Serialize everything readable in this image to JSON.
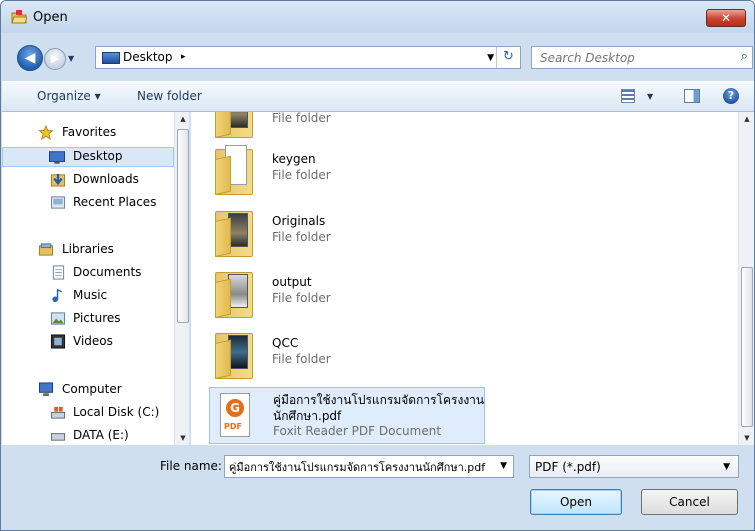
{
  "window": {
    "title": "Open",
    "close_label": "✕"
  },
  "nav": {
    "back_label": "◀",
    "forward_label": "▶",
    "address": {
      "crumb": "Desktop",
      "crumb_arrow": "▸"
    },
    "refresh_label": "↻",
    "search_placeholder": "Search Desktop",
    "search_icon": "search-icon"
  },
  "toolbar": {
    "organize_label": "Organize ▾",
    "new_folder_label": "New folder",
    "help_label": "?"
  },
  "sidebar": {
    "items": [
      {
        "label": "Favorites",
        "icon": "star-icon"
      },
      {
        "label": "Desktop",
        "icon": "desktop-icon",
        "selected": true
      },
      {
        "label": "Downloads",
        "icon": "downloads-icon"
      },
      {
        "label": "Recent Places",
        "icon": "recent-places-icon"
      },
      {
        "label": "Libraries",
        "icon": "libraries-icon"
      },
      {
        "label": "Documents",
        "icon": "documents-icon"
      },
      {
        "label": "Music",
        "icon": "music-icon"
      },
      {
        "label": "Pictures",
        "icon": "pictures-icon"
      },
      {
        "label": "Videos",
        "icon": "videos-icon"
      },
      {
        "label": "Computer",
        "icon": "computer-icon"
      },
      {
        "label": "Local Disk (C:)",
        "icon": "local-disk-icon"
      },
      {
        "label": "DATA (E:)",
        "icon": "drive-icon"
      }
    ]
  },
  "files": [
    {
      "name": "",
      "type": "File folder",
      "icon": "folder-icon"
    },
    {
      "name": "keygen",
      "type": "File folder",
      "icon": "folder-icon"
    },
    {
      "name": "Originals",
      "type": "File folder",
      "icon": "folder-icon"
    },
    {
      "name": "output",
      "type": "File folder",
      "icon": "folder-icon"
    },
    {
      "name": "QCC",
      "type": "File folder",
      "icon": "folder-icon"
    },
    {
      "name": "คู่มือการใช้งานโปรแกรมจัดการโครงงาน",
      "name2": "นักศึกษา.pdf",
      "type": "Foxit Reader PDF Document",
      "icon": "pdf-icon",
      "pdf_tag": "PDF",
      "logo": "G",
      "selected": true
    }
  ],
  "bottom": {
    "file_name_label": "File name:",
    "file_name_value": "คู่มือการใช้งานโปรแกรมจัดการโครงงานนักศึกษา.pdf",
    "file_type_value": "PDF (*.pdf)",
    "open_label": "Open",
    "cancel_label": "Cancel"
  }
}
